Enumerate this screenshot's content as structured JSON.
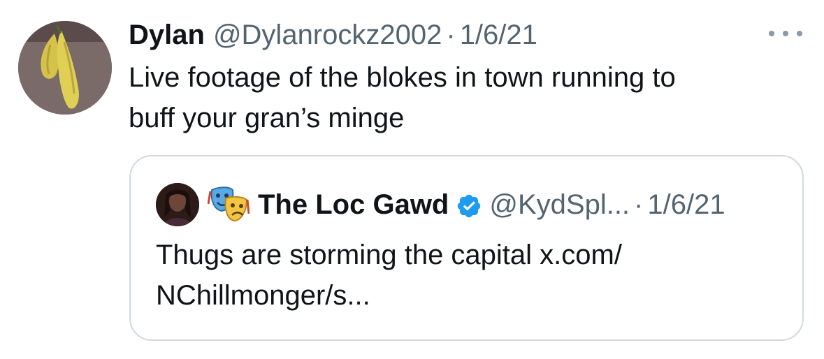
{
  "tweet": {
    "display_name": "Dylan",
    "handle": "@Dylanrockz2002",
    "separator": "·",
    "date": "1/6/21",
    "text_line1": "Live footage of the blokes in town running to",
    "text_line2": "buff your gran’s minge",
    "more_icon": "more-horizontal-icon"
  },
  "quoted_tweet": {
    "display_name": "The Loc Gawd",
    "emoji_icon": "performing-arts-masks-icon",
    "verified_icon": "verified-badge-icon",
    "handle": "@KydSpl...",
    "separator": "·",
    "date": "1/6/21",
    "text_line1": "Thugs are storming the capital x.com/",
    "text_line2": "NChillmonger/s..."
  },
  "colors": {
    "text_primary": "#0f1419",
    "text_secondary": "#536471",
    "border": "#cfd9de",
    "verified_blue": "#1d9bf0"
  }
}
